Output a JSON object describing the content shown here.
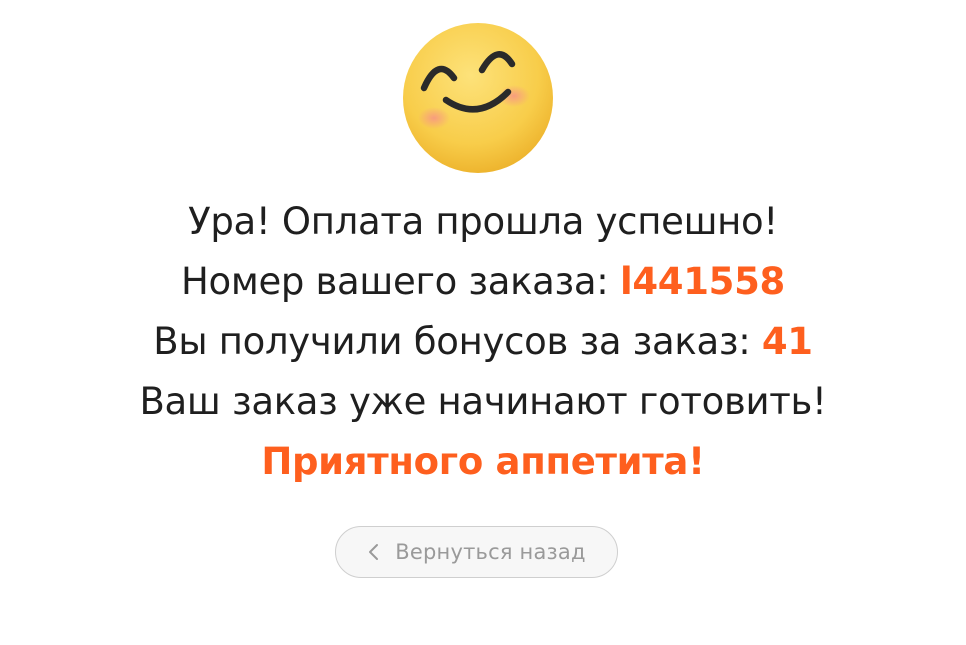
{
  "emoji": {
    "icon": "smiling-face-icon"
  },
  "message": {
    "line1": "Ура! Оплата прошла успешно!",
    "order_label": "Номер вашего заказа:",
    "order_number": "l441558",
    "bonus_label": "Вы получили бонусов за заказ:",
    "bonus_value": "41",
    "line4": "Ваш заказ уже начинают готовить!",
    "line5": "Приятного аппетита!"
  },
  "back_button": {
    "label": "Вернуться назад",
    "icon": "chevron-left-icon"
  },
  "colors": {
    "accent": "#fe5f1e",
    "text": "#1f1f1f",
    "button_text": "#9a9a9a",
    "button_border": "#cfcfcf"
  }
}
